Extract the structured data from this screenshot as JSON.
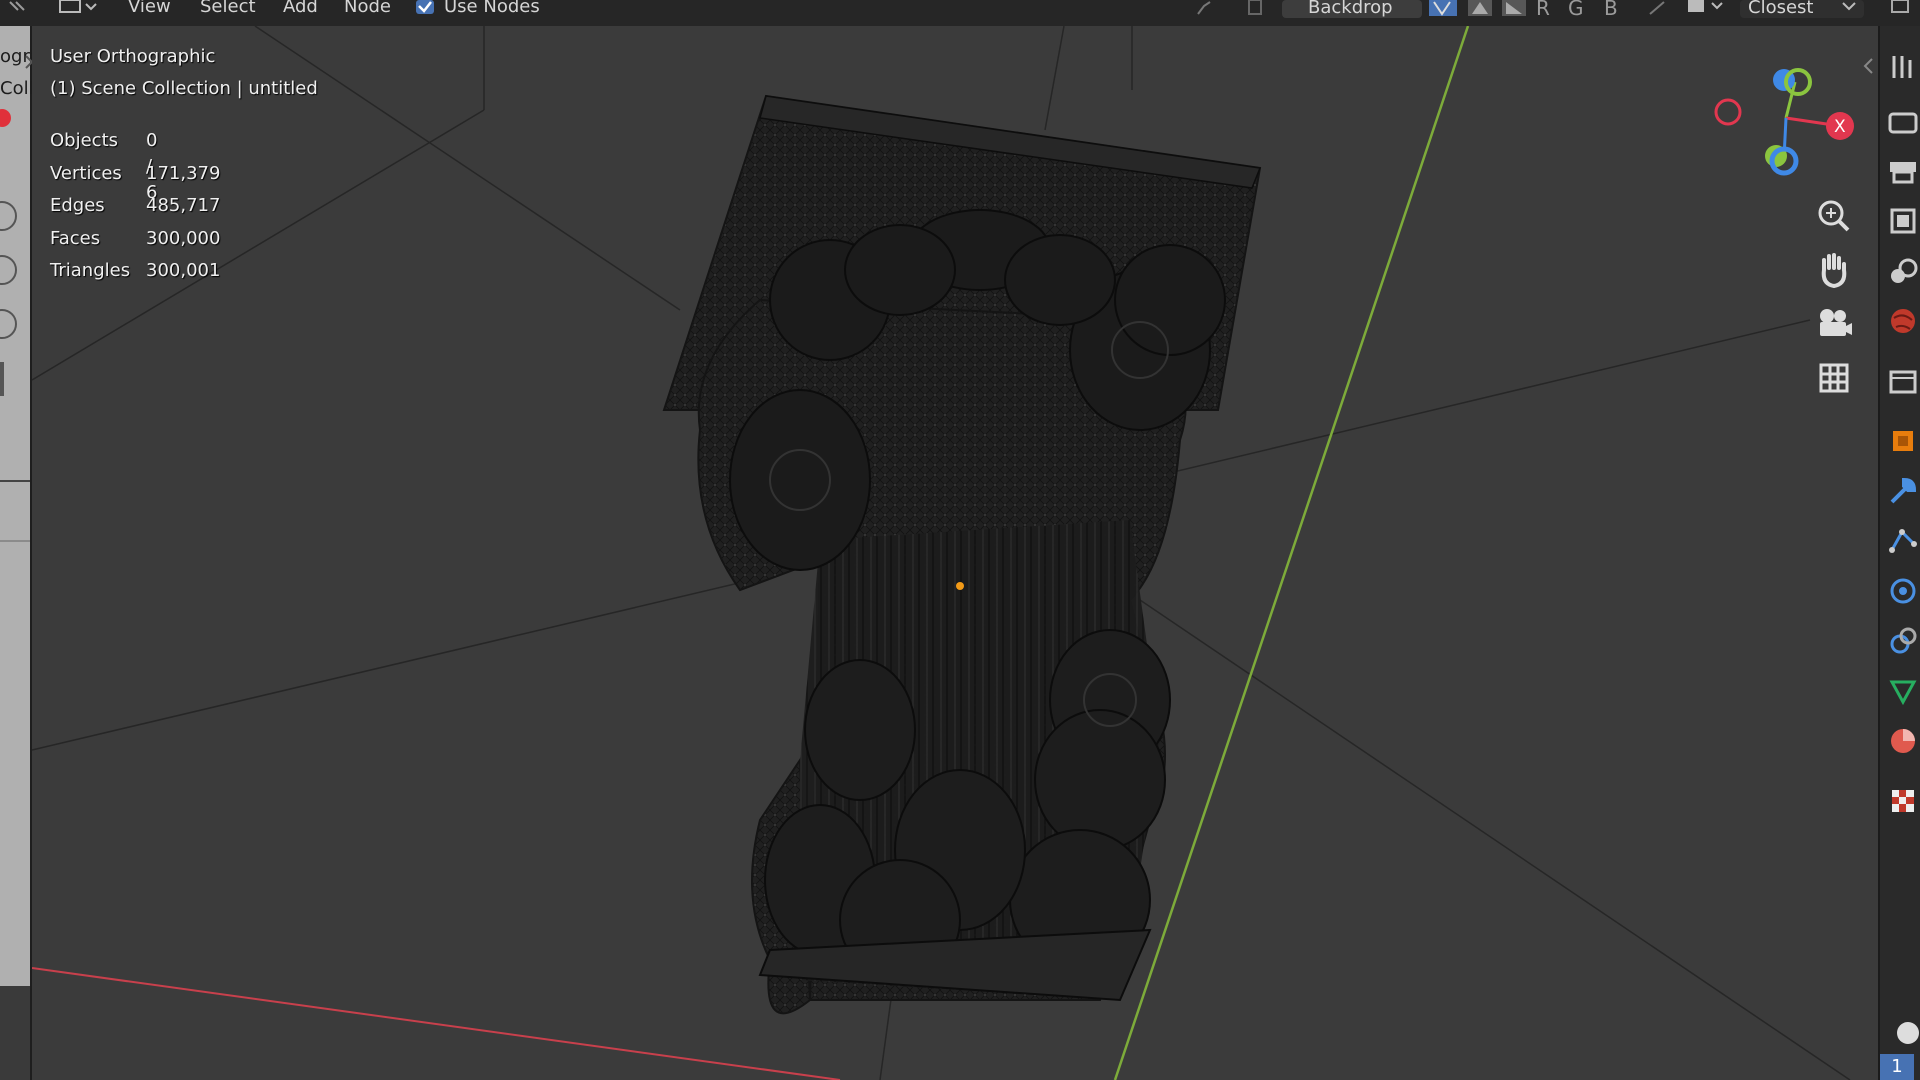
{
  "header": {
    "menus": [
      "View",
      "Select",
      "Add",
      "Node"
    ],
    "use_nodes_label": "Use Nodes",
    "use_nodes_checked": true,
    "backdrop_label": "Backdrop",
    "channels": [
      "R",
      "G",
      "B"
    ],
    "interp_label": "Closest"
  },
  "left_panel": {
    "fragments": [
      "ogra",
      "Coll"
    ]
  },
  "viewport": {
    "view_name": "User Orthographic",
    "collection_line": "(1) Scene Collection | untitled",
    "stats": [
      {
        "label": "Objects",
        "value": "0 / 6"
      },
      {
        "label": "Vertices",
        "value": "171,379"
      },
      {
        "label": "Edges",
        "value": "485,717"
      },
      {
        "label": "Faces",
        "value": "300,000"
      },
      {
        "label": "Triangles",
        "value": "300,001"
      }
    ],
    "gizmo": {
      "x_label": "X",
      "colors": {
        "x": "#e2374f",
        "y": "#8bc53f",
        "z": "#3f89e6"
      }
    },
    "nav_buttons": [
      "zoom-icon",
      "hand-pan-icon",
      "camera-icon",
      "grid-icon"
    ]
  },
  "properties_tabs": [
    "tool-icon",
    "render-icon",
    "output-icon",
    "view-layer-icon",
    "scene-icon",
    "world-icon",
    "collection-icon",
    "object-icon",
    "modifier-icon",
    "particles-icon",
    "physics-icon",
    "constraints-icon",
    "data-icon",
    "material-icon",
    "texture-icon"
  ],
  "frame_badge": "1",
  "colors": {
    "background": "#3b3b3b",
    "axis_x": "#c8404c",
    "axis_y": "#7dab3a",
    "origin": "#f29a17"
  }
}
